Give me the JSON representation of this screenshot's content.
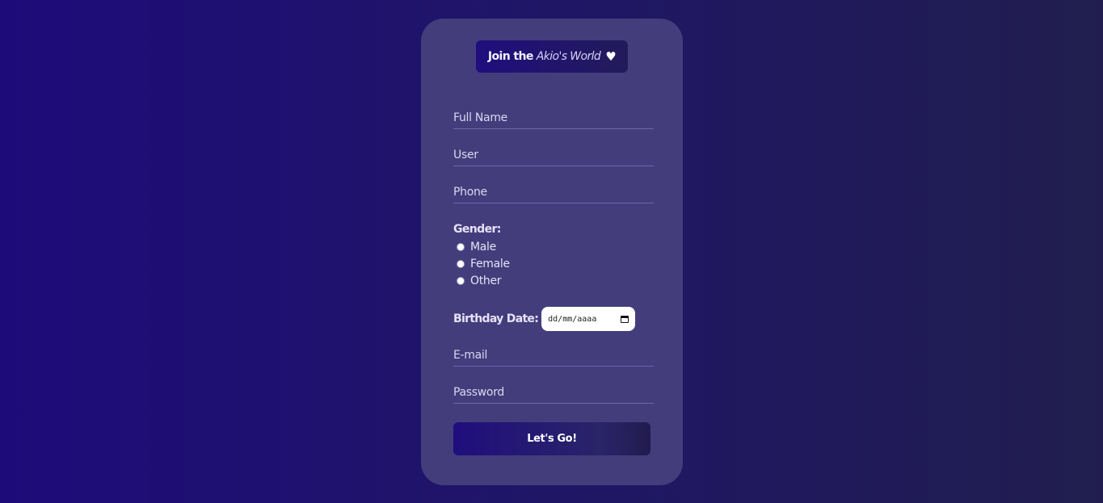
{
  "header": {
    "title_bold": "Join the",
    "title_italic": "Akio's World",
    "heart_icon": "heart-icon"
  },
  "form": {
    "full_name_placeholder": "Full Name",
    "user_placeholder": "User",
    "phone_placeholder": "Phone",
    "gender_label": "Gender:",
    "gender_options": [
      "Male",
      "Female",
      "Other"
    ],
    "birthday_label": "Birthday Date:",
    "date_placeholder": "dd/mm/aaaa",
    "email_placeholder": "E-mail",
    "password_placeholder": "Password",
    "submit_label": "Let's Go!"
  },
  "colors": {
    "background_start": "#1e0b7a",
    "background_end": "#211e4f",
    "card": "#433d7c",
    "accent": "#1f0e7d"
  }
}
